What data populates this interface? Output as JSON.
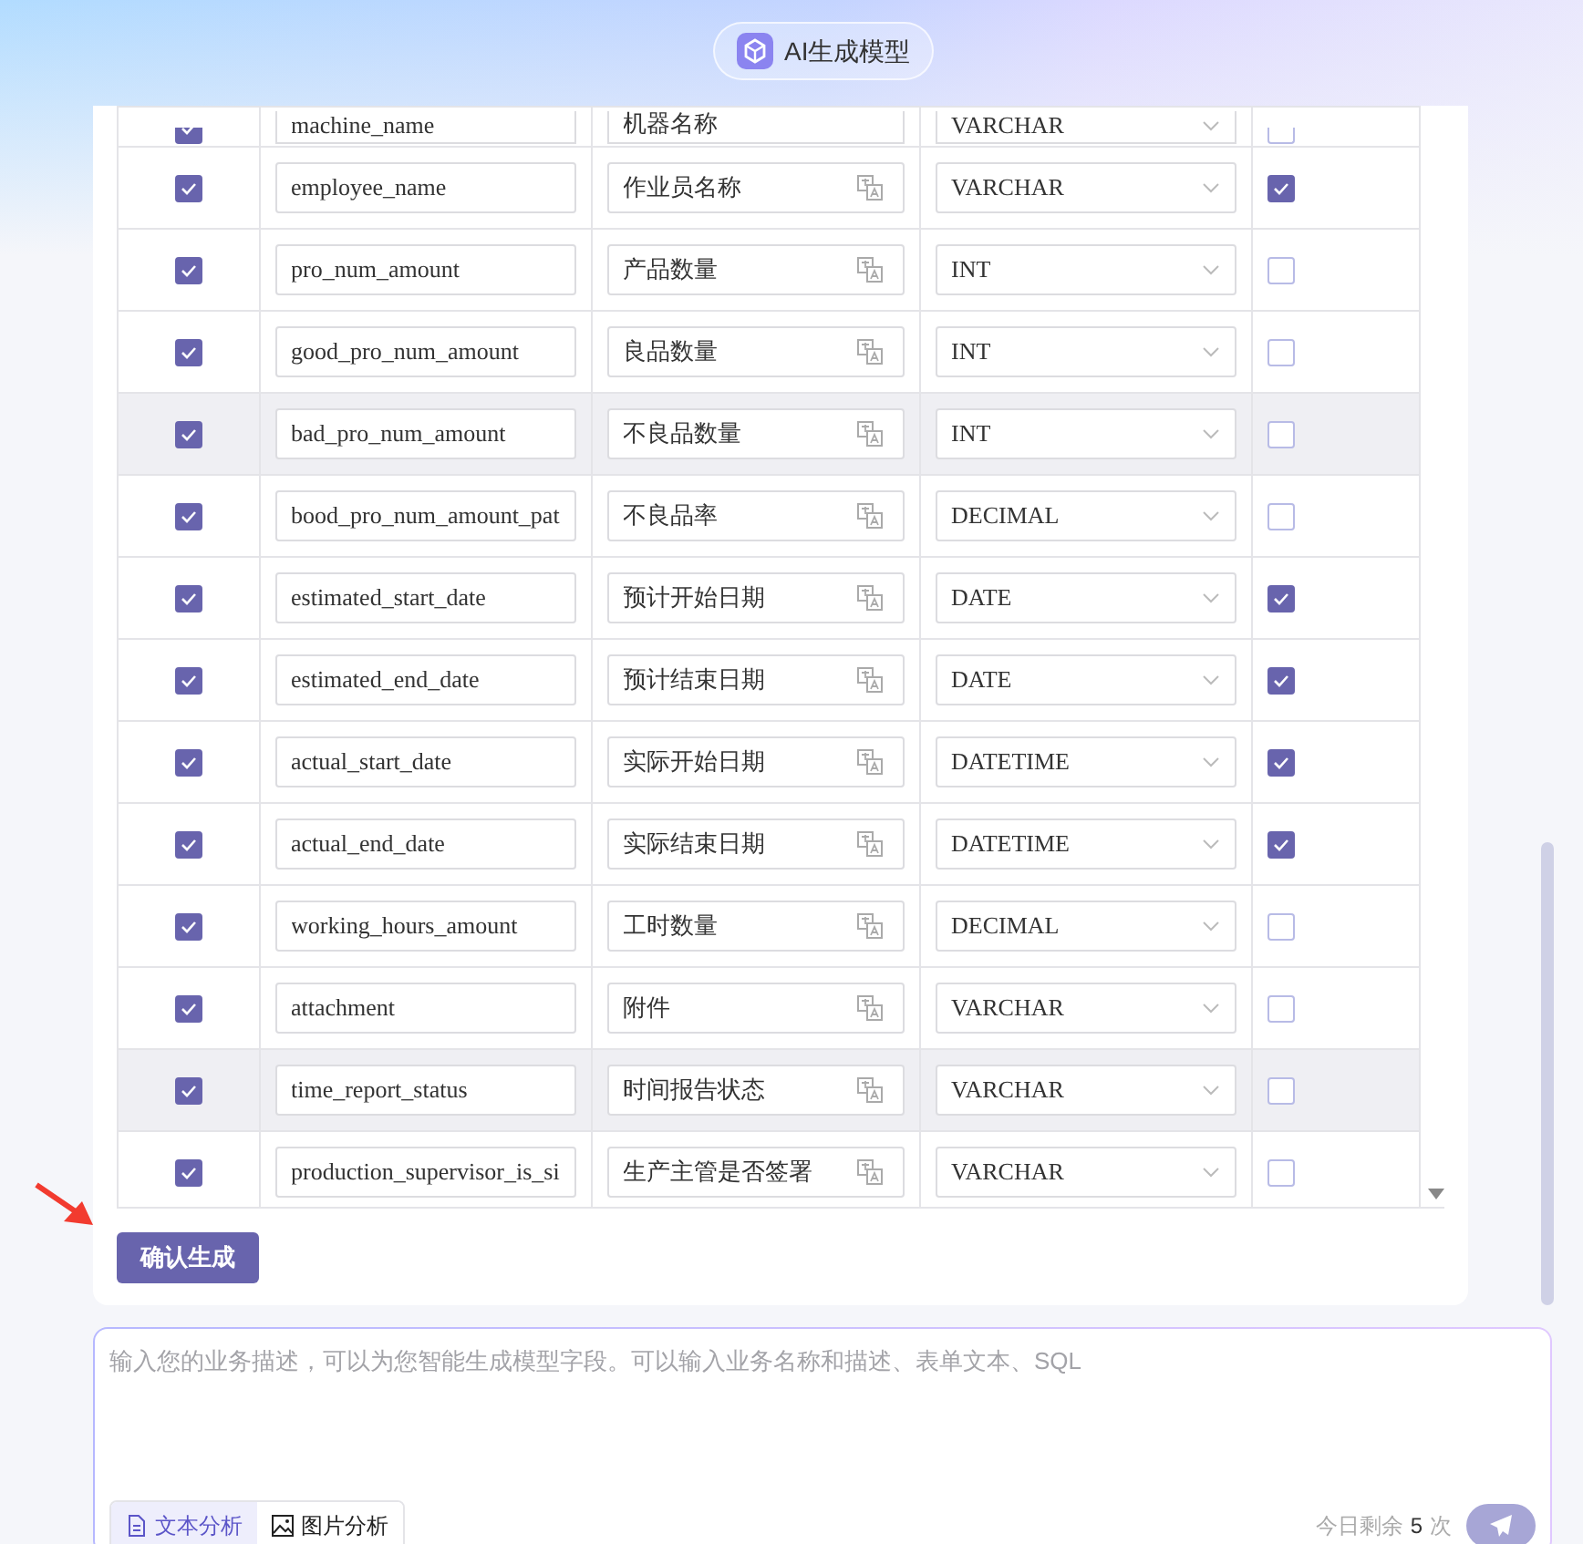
{
  "header": {
    "title": "AI生成模型"
  },
  "fields": [
    {
      "enabled": true,
      "name": "machine_name",
      "label": "机器名称",
      "type": "VARCHAR",
      "required": false,
      "highlighted": false
    },
    {
      "enabled": true,
      "name": "employee_name",
      "label": "作业员名称",
      "type": "VARCHAR",
      "required": true,
      "highlighted": false
    },
    {
      "enabled": true,
      "name": "pro_num_amount",
      "label": "产品数量",
      "type": "INT",
      "required": false,
      "highlighted": false
    },
    {
      "enabled": true,
      "name": "good_pro_num_amount",
      "label": "良品数量",
      "type": "INT",
      "required": false,
      "highlighted": false
    },
    {
      "enabled": true,
      "name": "bad_pro_num_amount",
      "label": "不良品数量",
      "type": "INT",
      "required": false,
      "highlighted": true
    },
    {
      "enabled": true,
      "name": "bood_pro_num_amount_pat",
      "label": "不良品率",
      "type": "DECIMAL",
      "required": false,
      "highlighted": false
    },
    {
      "enabled": true,
      "name": "estimated_start_date",
      "label": "预计开始日期",
      "type": "DATE",
      "required": true,
      "highlighted": false
    },
    {
      "enabled": true,
      "name": "estimated_end_date",
      "label": "预计结束日期",
      "type": "DATE",
      "required": true,
      "highlighted": false
    },
    {
      "enabled": true,
      "name": "actual_start_date",
      "label": "实际开始日期",
      "type": "DATETIME",
      "required": true,
      "highlighted": false
    },
    {
      "enabled": true,
      "name": "actual_end_date",
      "label": "实际结束日期",
      "type": "DATETIME",
      "required": true,
      "highlighted": false
    },
    {
      "enabled": true,
      "name": "working_hours_amount",
      "label": "工时数量",
      "type": "DECIMAL",
      "required": false,
      "highlighted": false
    },
    {
      "enabled": true,
      "name": "attachment",
      "label": "附件",
      "type": "VARCHAR",
      "required": false,
      "highlighted": false
    },
    {
      "enabled": true,
      "name": "time_report_status",
      "label": "时间报告状态",
      "type": "VARCHAR",
      "required": false,
      "highlighted": true
    },
    {
      "enabled": true,
      "name": "production_supervisor_is_si",
      "label": "生产主管是否签署",
      "type": "VARCHAR",
      "required": false,
      "highlighted": false
    }
  ],
  "confirm_button": "确认生成",
  "prompt": {
    "placeholder": "输入您的业务描述，可以为您智能生成模型字段。可以输入业务名称和描述、表单文本、SQL",
    "modes": [
      {
        "label": "文本分析",
        "kind": "text",
        "selected": true
      },
      {
        "label": "图片分析",
        "kind": "image",
        "selected": false
      }
    ],
    "quota_label": "今日剩余",
    "quota_count": "5",
    "quota_unit": "次"
  }
}
